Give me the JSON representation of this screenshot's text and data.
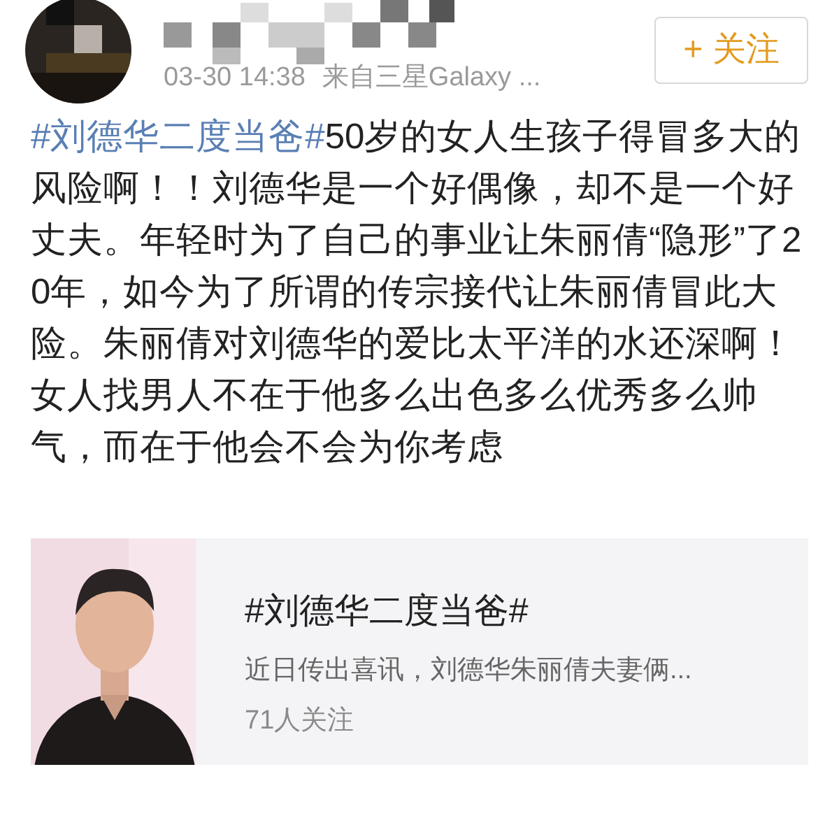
{
  "post": {
    "timestamp": "03-30 14:38",
    "source": "来自三星Galaxy ...",
    "follow_button": "+ 关注",
    "hashtag": "#刘德华二度当爸#",
    "text": "50岁的女人生孩子得冒多大的风险啊！！刘德华是一个好偶像，却不是一个好丈夫。年轻时为了自己的事业让朱丽倩“隐形”了20年，如今为了所谓的传宗接代让朱丽倩冒此大险。朱丽倩对刘德华的爱比太平洋的水还深啊！女人找男人不在于他多么出色多么优秀多么帅气，而在于他会不会为你考虑"
  },
  "topic_card": {
    "title": "#刘德华二度当爸#",
    "description": "近日传出喜讯，刘德华朱丽倩夫妻俩...",
    "followers": "71人关注"
  }
}
